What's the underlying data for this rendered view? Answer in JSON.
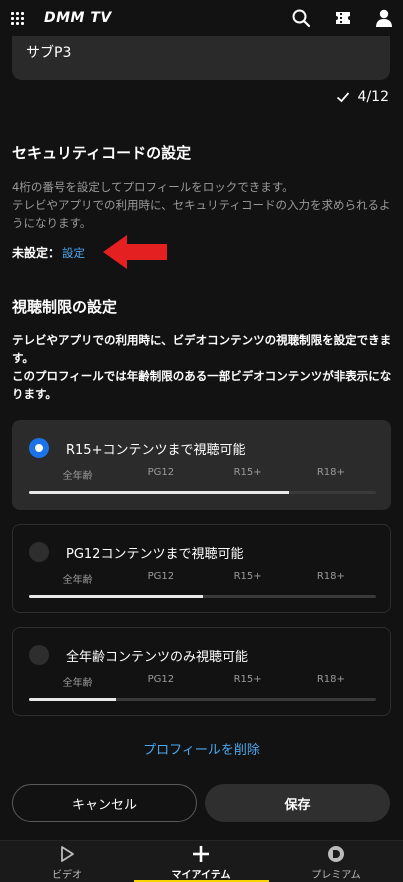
{
  "header": {
    "logo": "DMM TV",
    "icons": [
      "grid-menu-icon",
      "search-icon",
      "ticket-icon",
      "user-icon"
    ]
  },
  "profile_name_field": {
    "value": "サブP3",
    "counter": "4/12"
  },
  "security_code": {
    "title": "セキュリティコードの設定",
    "description_line1": "4桁の番号を設定してプロフィールをロックできます。",
    "description_line2": "テレビやアプリでの利用時に、セキュリティコードの入力を求められるようになります。",
    "status_label": "未設定：",
    "setup_link": "設定"
  },
  "viewing_restriction": {
    "title": "視聴制限の設定",
    "description_line1": "テレビやアプリでの利用時に、ビデオコンテンツの視聴制限を設定できます。",
    "description_line2": "このプロフィールでは年齢制限のある一部ビデオコンテンツが非表示になります。",
    "level_labels": [
      "全年齢",
      "PG12",
      "R15+",
      "R18+"
    ],
    "options": [
      {
        "label": "R15+コンテンツまで視聴可能",
        "selected": true,
        "fill_fraction": 0.75
      },
      {
        "label": "PG12コンテンツまで視聴可能",
        "selected": false,
        "fill_fraction": 0.5
      },
      {
        "label": "全年齢コンテンツのみ視聴可能",
        "selected": false,
        "fill_fraction": 0.25
      }
    ]
  },
  "delete_profile_link": "プロフィールを削除",
  "buttons": {
    "cancel": "キャンセル",
    "save": "保存"
  },
  "bottom_nav": {
    "items": [
      {
        "label": "ビデオ",
        "icon": "play-icon",
        "active": false
      },
      {
        "label": "マイアイテム",
        "icon": "plus-icon",
        "active": true
      },
      {
        "label": "プレミアム",
        "icon": "premium-d-icon",
        "active": false
      }
    ]
  },
  "colors": {
    "background": "#121212",
    "accent_blue": "#1a73e8",
    "link_blue": "#4aa8f0",
    "nav_active_yellow": "#f5d400",
    "annotation_arrow": "#e52020"
  }
}
